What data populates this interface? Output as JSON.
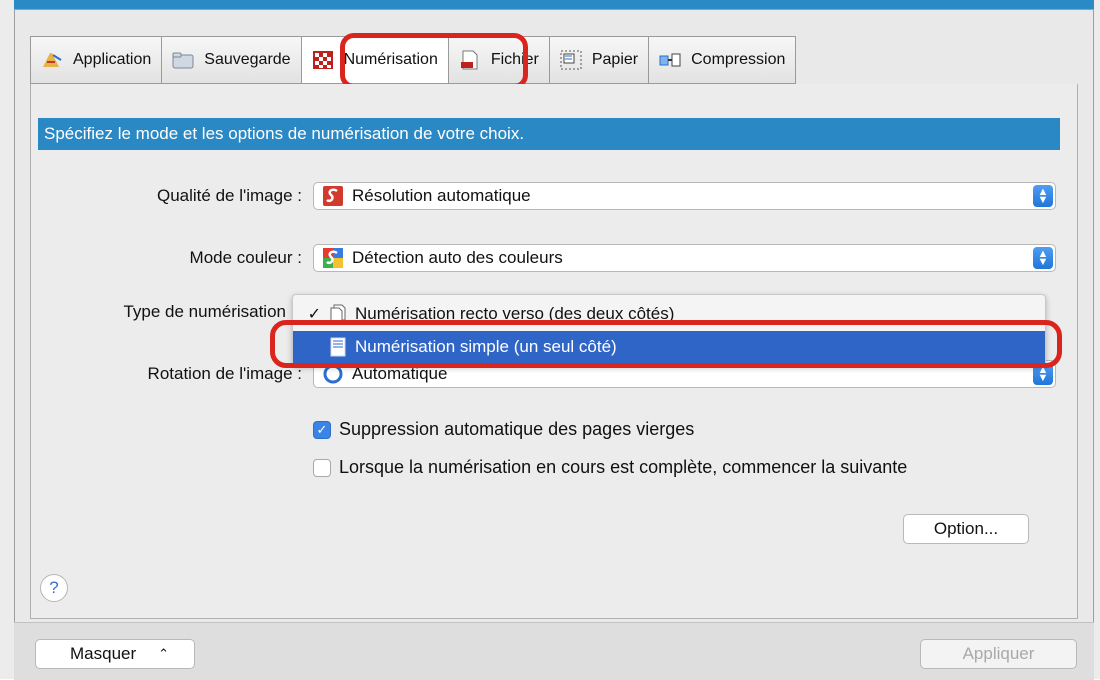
{
  "colors": {
    "accent": "#2a89c4",
    "selection": "#2f65c7",
    "highlight_outline": "#d9251d",
    "checkbox_on": "#3a84e6"
  },
  "tabs": [
    {
      "label": "Application",
      "icon": "application-icon"
    },
    {
      "label": "Sauvegarde",
      "icon": "folder-icon"
    },
    {
      "label": "Numérisation",
      "icon": "scan-icon",
      "active": true
    },
    {
      "label": "Fichier",
      "icon": "file-icon"
    },
    {
      "label": "Papier",
      "icon": "paper-icon"
    },
    {
      "label": "Compression",
      "icon": "compression-icon"
    }
  ],
  "banner": "Spécifiez le mode et les options de numérisation de votre choix.",
  "fields": {
    "image_quality": {
      "label": "Qualité de l'image :",
      "value": "Résolution automatique",
      "icon": "auto-resolution-icon"
    },
    "color_mode": {
      "label": "Mode couleur :",
      "value": "Détection auto des couleurs",
      "icon": "auto-color-icon"
    },
    "scan_type": {
      "label": "Type de numérisation",
      "icon": "duplex-icon"
    },
    "rotation": {
      "label": "Rotation de l'image :",
      "value": "Automatique",
      "icon": "rotation-icon"
    }
  },
  "scan_type_menu": {
    "items": [
      {
        "label": "Numérisation recto verso (des deux côtés)",
        "checked": true,
        "icon": "duplex-page-icon"
      },
      {
        "label": "Numérisation simple (un seul côté)",
        "selected": true,
        "icon": "simplex-page-icon"
      }
    ]
  },
  "checkboxes": [
    {
      "label": "Suppression automatique des pages vierges",
      "checked": true
    },
    {
      "label": "Lorsque la numérisation en cours est complète, commencer la suivante",
      "checked": false
    }
  ],
  "buttons": {
    "option": "Option...",
    "hide": "Masquer",
    "apply": "Appliquer",
    "help": "?"
  }
}
